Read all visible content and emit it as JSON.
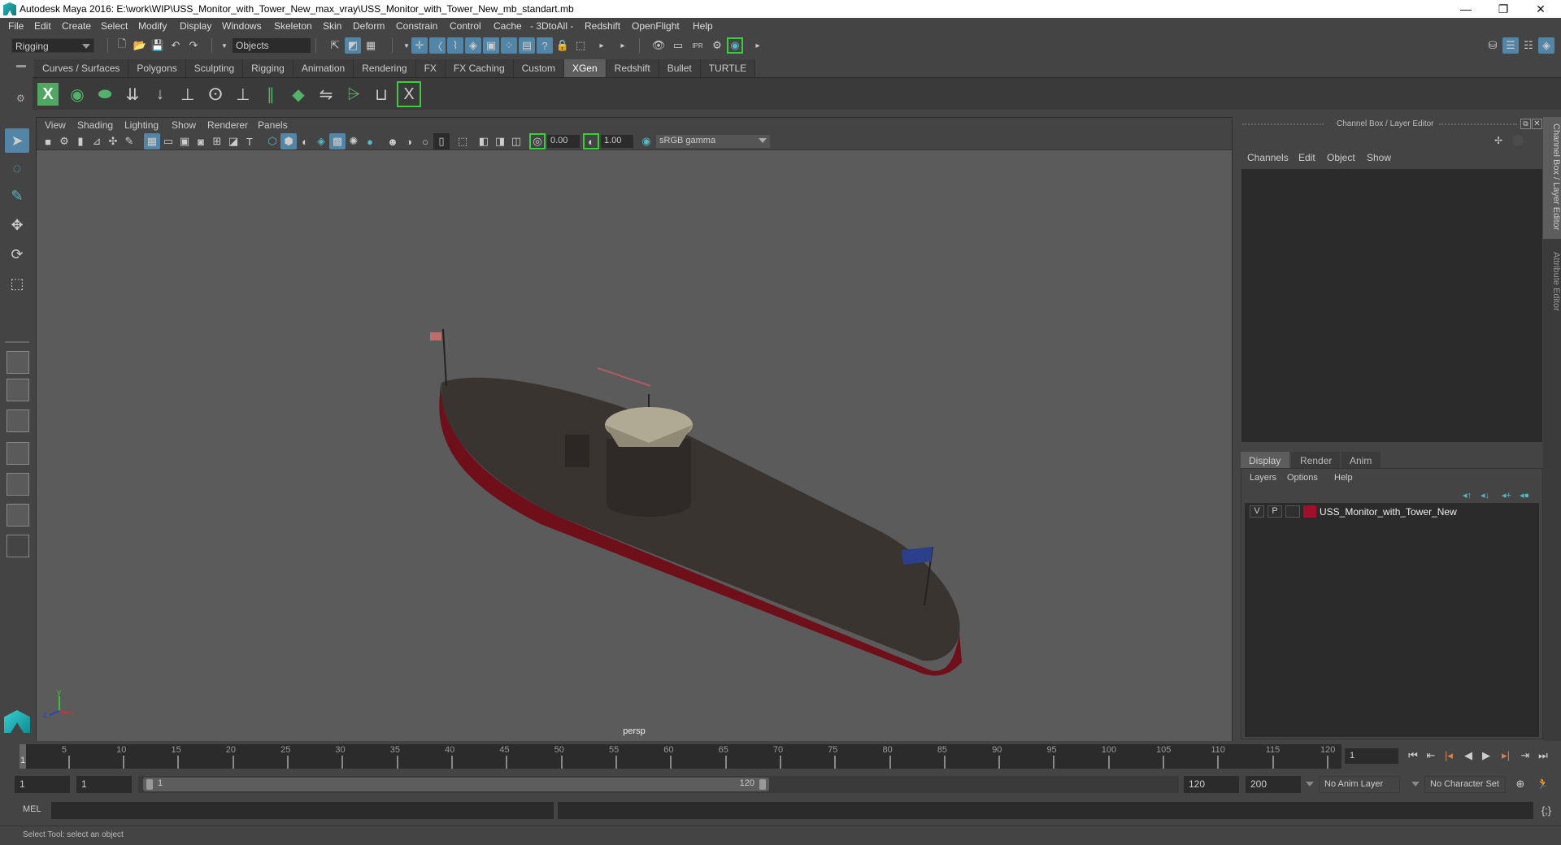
{
  "window": {
    "title": "Autodesk Maya 2016: E:\\work\\WIP\\USS_Monitor_with_Tower_New_max_vray\\USS_Monitor_with_Tower_New_mb_standart.mb",
    "controls": {
      "minimize": "—",
      "maximize": "❐",
      "close": "✕"
    }
  },
  "menubar": [
    "File",
    "Edit",
    "Create",
    "Select",
    "Modify",
    "Display",
    "Windows",
    "Skeleton",
    "Skin",
    "Deform",
    "Constrain",
    "Control",
    "Cache",
    "- 3DtoAll -",
    "Redshift",
    "OpenFlight",
    "Help"
  ],
  "statusline": {
    "mode": "Rigging",
    "objects_field": "Objects"
  },
  "shelf": {
    "tabs": [
      "Curves / Surfaces",
      "Polygons",
      "Sculpting",
      "Rigging",
      "Animation",
      "Rendering",
      "FX",
      "FX Caching",
      "Custom",
      "XGen",
      "Redshift",
      "Bullet",
      "TURTLE"
    ],
    "active_tab": "XGen",
    "icons": [
      "xgen-editor-icon",
      "xgen-preview-icon",
      "xgen-clear-icon",
      "xgen-add-guides-icon",
      "xgen-place-guides-icon",
      "xgen-add-guide-icon",
      "xgen-sculpt-guide-icon",
      "xgen-lock-guide-icon",
      "xgen-guide-length-icon",
      "xgen-density-icon",
      "xgen-flip-guide-icon",
      "xgen-select-guide-icon",
      "xgen-guide-region-icon",
      "xgen-library-icon"
    ]
  },
  "viewport": {
    "menu": [
      "View",
      "Shading",
      "Lighting",
      "Show",
      "Renderer",
      "Panels"
    ],
    "exposure": "0.00",
    "gamma": "1.00",
    "color_space": "sRGB gamma",
    "camera_label": "persp",
    "axis": {
      "x": "x",
      "y": "y",
      "z": "z"
    }
  },
  "channel_box": {
    "title": "Channel Box / Layer Editor",
    "menu": [
      "Channels",
      "Edit",
      "Object",
      "Show"
    ],
    "layer_tabs": [
      "Display",
      "Render",
      "Anim"
    ],
    "active_layer_tab": "Display",
    "layer_menu": [
      "Layers",
      "Options",
      "Help"
    ],
    "layers": [
      {
        "visible": "V",
        "playback": "P",
        "name": "USS_Monitor_with_Tower_New",
        "color": "#a0102a"
      }
    ]
  },
  "side_tabs": [
    "Channel Box / Layer Editor",
    "Attribute Editor"
  ],
  "timeline": {
    "start": 1,
    "end": 120,
    "current_frame": "1",
    "tick_labels": [
      "5",
      "10",
      "15",
      "20",
      "25",
      "30",
      "35",
      "40",
      "45",
      "50",
      "55",
      "60",
      "65",
      "70",
      "75",
      "80",
      "85",
      "90",
      "95",
      "100",
      "105",
      "110",
      "115",
      "120"
    ],
    "current_field": "1"
  },
  "range": {
    "start_time": "1",
    "playback_start": "1",
    "slider_start": "1",
    "slider_end": "120",
    "playback_end": "120",
    "end_time": "200",
    "anim_layer": "No Anim Layer",
    "character_set": "No Character Set"
  },
  "command_line": {
    "label": "MEL",
    "value": ""
  },
  "help_line": "Select Tool: select an object",
  "colors": {
    "accent": "#5285a6",
    "xgen_green": "#52b26a",
    "hull_red": "#7a0f1c",
    "deck": "#3a3431",
    "turret_top": "#b0a993"
  }
}
